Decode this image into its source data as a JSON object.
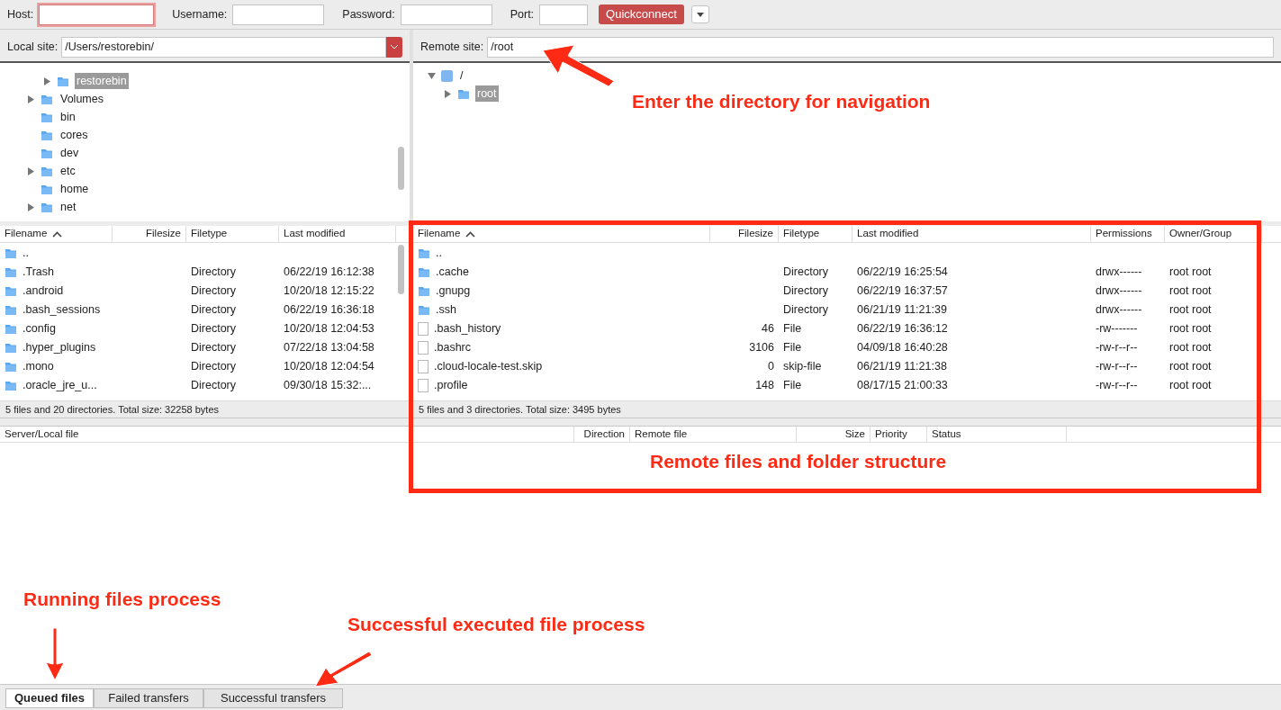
{
  "toolbar": {
    "fields": [
      {
        "label": "Host:",
        "focused": true
      },
      {
        "label": "Username:",
        "focused": false
      },
      {
        "label": "Password:",
        "focused": false
      },
      {
        "label": "Port:",
        "focused": false
      }
    ],
    "quickconnect": "Quickconnect"
  },
  "local": {
    "site_label": "Local site:",
    "path": "/Users/restorebin/",
    "tree": [
      {
        "children": [
          {
            "name": "restorebin",
            "expanded": false,
            "selected": true
          }
        ]
      },
      {
        "name": "Volumes",
        "expanded": false,
        "selected": false
      },
      {
        "name": "bin",
        "selected": false
      },
      {
        "name": "cores",
        "selected": false
      },
      {
        "name": "dev",
        "selected": false
      },
      {
        "name": "etc",
        "expanded": false,
        "selected": false
      },
      {
        "name": "home",
        "selected": false
      },
      {
        "name": "net",
        "expanded": false,
        "selected": false
      }
    ],
    "columns": [
      "Filename",
      "Filesize",
      "Filetype",
      "Last modified"
    ],
    "rows": [
      {
        "kind": "folder",
        "name": ".."
      },
      {
        "kind": "folder",
        "name": ".Trash",
        "type": "Directory",
        "modified": "06/22/19 16:12:38"
      },
      {
        "kind": "folder",
        "name": ".android",
        "type": "Directory",
        "modified": "10/20/18 12:15:22"
      },
      {
        "kind": "folder",
        "name": ".bash_sessions",
        "type": "Directory",
        "modified": "06/22/19 16:36:18"
      },
      {
        "kind": "folder",
        "name": ".config",
        "type": "Directory",
        "modified": "10/20/18 12:04:53"
      },
      {
        "kind": "folder",
        "name": ".hyper_plugins",
        "type": "Directory",
        "modified": "07/22/18 13:04:58"
      },
      {
        "kind": "folder",
        "name": ".mono",
        "type": "Directory",
        "modified": "10/20/18 12:04:54"
      },
      {
        "kind": "folder",
        "name": ".oracle_jre_u...",
        "type": "Directory",
        "modified": "09/30/18 15:32:..."
      }
    ],
    "status": "5 files and 20 directories. Total size: 32258 bytes"
  },
  "remote": {
    "site_label": "Remote site:",
    "path": "/root",
    "tree": [
      {
        "name": "/",
        "kind": "unknown",
        "expanded": true,
        "selected": false,
        "children": [
          {
            "name": "root",
            "expanded": false,
            "selected": true
          }
        ]
      }
    ],
    "columns": [
      "Filename",
      "Filesize",
      "Filetype",
      "Last modified",
      "Permissions",
      "Owner/Group"
    ],
    "rows": [
      {
        "kind": "folder",
        "name": ".."
      },
      {
        "kind": "folder",
        "name": ".cache",
        "type": "Directory",
        "modified": "06/22/19 16:25:54",
        "permissions": "drwx------",
        "owner": "root root"
      },
      {
        "kind": "folder",
        "name": ".gnupg",
        "type": "Directory",
        "modified": "06/22/19 16:37:57",
        "permissions": "drwx------",
        "owner": "root root"
      },
      {
        "kind": "folder",
        "name": ".ssh",
        "type": "Directory",
        "modified": "06/21/19 11:21:39",
        "permissions": "drwx------",
        "owner": "root root"
      },
      {
        "kind": "file",
        "name": ".bash_history",
        "size": "46",
        "type": "File",
        "modified": "06/22/19 16:36:12",
        "permissions": "-rw-------",
        "owner": "root root"
      },
      {
        "kind": "file",
        "name": ".bashrc",
        "size": "3106",
        "type": "File",
        "modified": "04/09/18 16:40:28",
        "permissions": "-rw-r--r--",
        "owner": "root root"
      },
      {
        "kind": "file",
        "name": ".cloud-locale-test.skip",
        "size": "0",
        "type": "skip-file",
        "modified": "06/21/19 11:21:38",
        "permissions": "-rw-r--r--",
        "owner": "root root"
      },
      {
        "kind": "file",
        "name": ".profile",
        "size": "148",
        "type": "File",
        "modified": "08/17/15 21:00:33",
        "permissions": "-rw-r--r--",
        "owner": "root root"
      }
    ],
    "status": "5 files and 3 directories. Total size: 3495 bytes"
  },
  "queue": {
    "columns": [
      "Server/Local file",
      "Direction",
      "Remote file",
      "Size",
      "Priority",
      "Status"
    ],
    "tabs": [
      {
        "label": "Queued files",
        "selected": true
      },
      {
        "label": "Failed transfers",
        "selected": false
      },
      {
        "label": "Successful transfers",
        "selected": false
      }
    ]
  },
  "annotations": [
    {
      "kind": "arrow"
    },
    {
      "kind": "label",
      "text": "Enter the directory for navigation"
    },
    {
      "kind": "frame"
    },
    {
      "kind": "label",
      "text": "Remote files and folder structure"
    },
    {
      "kind": "label",
      "text": "Running files process"
    },
    {
      "kind": "arrow"
    },
    {
      "kind": "label",
      "text": "Successful executed file process"
    },
    {
      "kind": "arrow"
    }
  ]
}
